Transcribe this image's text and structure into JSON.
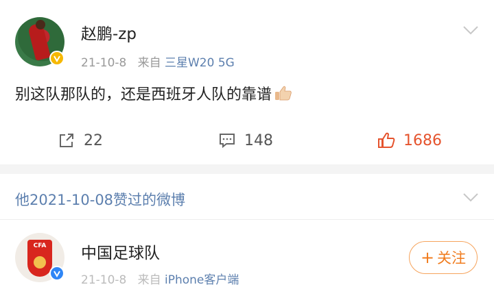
{
  "post": {
    "username": "赵鹏-zp",
    "date": "21-10-8",
    "source_prefix": "来自",
    "source": "三星W20 5G",
    "content": "别这队那队的，还是西班牙人队的靠谱",
    "emoji": "thumbs-up-emoji",
    "actions": {
      "repost_count": "22",
      "comment_count": "148",
      "like_count": "1686"
    }
  },
  "liked_section": {
    "title": "他2021-10-08赞过的微博"
  },
  "liked_post": {
    "username": "中国足球队",
    "crest_text": "CFA",
    "follow_label": "关注",
    "follow_plus": "+",
    "date": "21-10-8",
    "source_prefix": "来自",
    "source": "iPhone客户端"
  },
  "colors": {
    "like": "#e5532d",
    "link": "#5c7fae",
    "follow": "#f07b1d",
    "verified": "#f6b800"
  }
}
